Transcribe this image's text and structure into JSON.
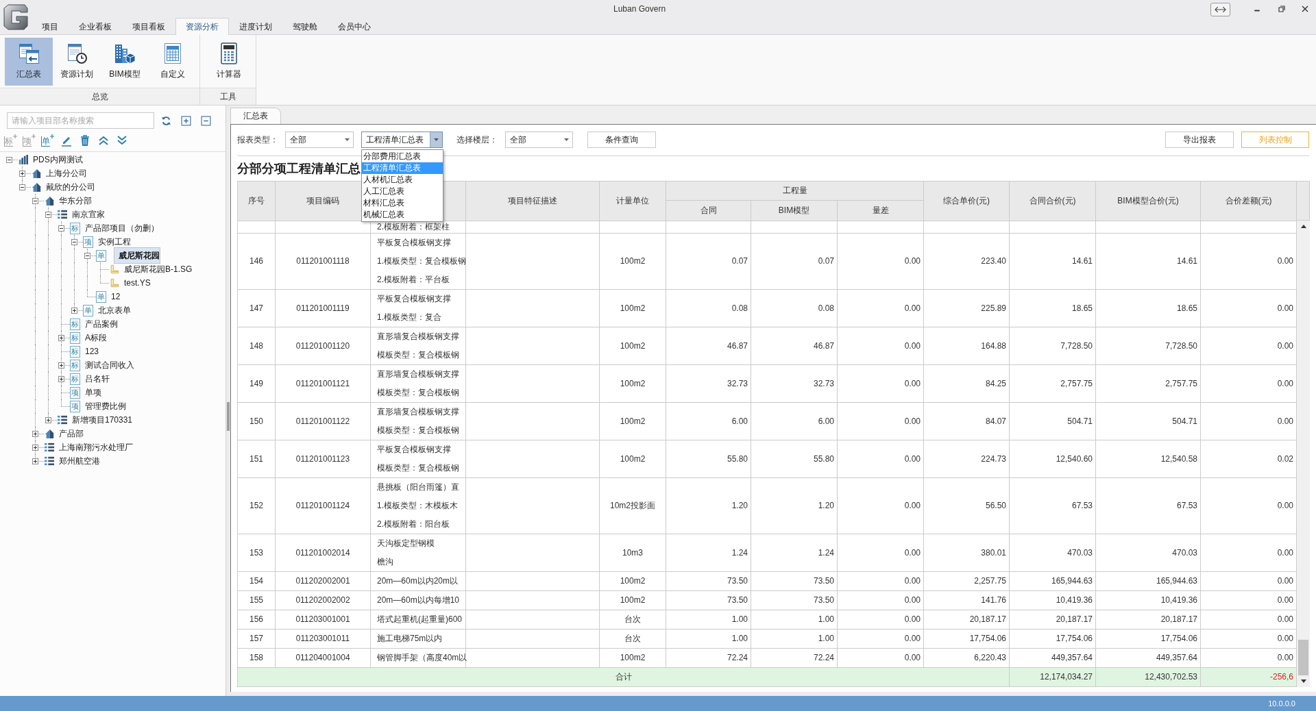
{
  "window": {
    "title": "Luban Govern"
  },
  "ribbon_tabs": [
    {
      "label": "项目",
      "selected": false
    },
    {
      "label": "企业看板",
      "selected": false
    },
    {
      "label": "项目看板",
      "selected": false
    },
    {
      "label": "资源分析",
      "selected": true
    },
    {
      "label": "进度计划",
      "selected": false
    },
    {
      "label": "驾驶舱",
      "selected": false
    },
    {
      "label": "会员中心",
      "selected": false
    }
  ],
  "ribbon_groups": [
    {
      "label": "总览",
      "buttons": [
        {
          "kind": "summary",
          "label": "汇总表",
          "selected": true
        },
        {
          "kind": "plan",
          "label": "资源计划",
          "selected": false
        },
        {
          "kind": "bim",
          "label": "BIM模型",
          "selected": false
        },
        {
          "kind": "custom",
          "label": "自定义",
          "selected": false
        }
      ]
    },
    {
      "label": "工具",
      "buttons": [
        {
          "kind": "calculator",
          "label": "计算器",
          "selected": false
        }
      ]
    }
  ],
  "sidebar": {
    "search": {
      "placeholder": "请输入项目部名称搜索"
    },
    "tools": [
      {
        "kind": "add",
        "label": "标",
        "disabled": true
      },
      {
        "kind": "add",
        "label": "项",
        "disabled": true
      },
      {
        "kind": "add",
        "label": "单",
        "disabled": false
      },
      {
        "kind": "edit",
        "disabled": false
      },
      {
        "kind": "delete",
        "disabled": false
      },
      {
        "kind": "move-up",
        "disabled": false
      },
      {
        "kind": "move-down",
        "disabled": false
      }
    ],
    "tree": [
      {
        "kind": "root",
        "label": "PDS内网测试",
        "expanded": true,
        "selected": false,
        "children": [
          {
            "kind": "office",
            "label": "上海分公司",
            "expanded": false,
            "selected": false
          },
          {
            "kind": "office",
            "label": "戴欣的分公司",
            "expanded": true,
            "selected": false,
            "children": [
              {
                "kind": "office",
                "label": "华东分部",
                "expanded": true,
                "selected": false,
                "children": [
                  {
                    "kind": "list",
                    "label": "南京宜家",
                    "expanded": true,
                    "selected": false,
                    "children": [
                      {
                        "kind": "badge",
                        "badge": "标",
                        "label": "产品部项目（勿删）",
                        "expanded": true,
                        "selected": false,
                        "children": [
                          {
                            "kind": "badge",
                            "badge": "项",
                            "label": "实例工程",
                            "expanded": true,
                            "selected": false,
                            "children": [
                              {
                                "kind": "badge",
                                "badge": "单",
                                "label": "威尼斯花园",
                                "expanded": true,
                                "selected": true,
                                "children": [
                                  {
                                    "kind": "file",
                                    "label": "威尼斯花园B-1.SG",
                                    "selected": false
                                  },
                                  {
                                    "kind": "file",
                                    "label": "test.YS",
                                    "selected": false
                                  }
                                ]
                              },
                              {
                                "kind": "badge",
                                "badge": "单",
                                "label": "12",
                                "selected": false
                              }
                            ]
                          },
                          {
                            "kind": "badge",
                            "badge": "单",
                            "label": "北京表单",
                            "expanded": false,
                            "selected": false
                          }
                        ]
                      },
                      {
                        "kind": "badge",
                        "badge": "标",
                        "label": "产品案例",
                        "selected": false
                      },
                      {
                        "kind": "badge",
                        "badge": "标",
                        "label": "A标段",
                        "expanded": false,
                        "selected": false
                      },
                      {
                        "kind": "badge",
                        "badge": "标",
                        "label": "123",
                        "selected": false
                      },
                      {
                        "kind": "badge",
                        "badge": "标",
                        "label": "测试合同收入",
                        "expanded": false,
                        "selected": false
                      },
                      {
                        "kind": "badge",
                        "badge": "标",
                        "label": "吕名轩",
                        "expanded": false,
                        "selected": false
                      },
                      {
                        "kind": "badge",
                        "badge": "项",
                        "label": "单项",
                        "selected": false
                      },
                      {
                        "kind": "badge",
                        "badge": "项",
                        "label": "管理费比例",
                        "selected": false
                      }
                    ]
                  },
                  {
                    "kind": "list",
                    "label": "新增项目170331",
                    "expanded": false,
                    "selected": false
                  }
                ]
              },
              {
                "kind": "office",
                "label": "产品部",
                "expanded": false,
                "selected": false
              },
              {
                "kind": "list",
                "label": "上海南翔污水处理厂",
                "expanded": false,
                "selected": false
              },
              {
                "kind": "list",
                "label": "郑州航空港",
                "expanded": false,
                "selected": false
              }
            ]
          }
        ]
      }
    ]
  },
  "document_tabs": [
    {
      "label": "汇总表",
      "selected": true
    }
  ],
  "filters": {
    "report_type": {
      "label": "报表类型：",
      "value": "全部"
    },
    "report": {
      "value": "工程清单汇总表",
      "open": true,
      "options": [
        {
          "label": "分部费用汇总表",
          "selected": false
        },
        {
          "label": "工程清单汇总表",
          "selected": true
        },
        {
          "label": "人材机汇总表",
          "selected": false
        },
        {
          "label": "人工汇总表",
          "selected": false
        },
        {
          "label": "材料汇总表",
          "selected": false
        },
        {
          "label": "机械汇总表",
          "selected": false
        }
      ]
    },
    "floor": {
      "label": "选择楼层：",
      "value": "全部"
    },
    "query_button": "条件查询"
  },
  "actions": [
    {
      "label": "导出报表",
      "highlighted": false
    },
    {
      "label": "列表控制",
      "highlighted": true
    }
  ],
  "report_title": "分部分项工程清单汇总",
  "table": {
    "columns": [
      {
        "kind": "text",
        "label": "序号"
      },
      {
        "kind": "text",
        "label": "项目编码"
      },
      {
        "kind": "blank"
      },
      {
        "kind": "text",
        "label": "项目特征描述"
      },
      {
        "kind": "text",
        "label": "计量单位"
      },
      {
        "kind": "group",
        "label": "工程量",
        "subcolumns": [
          "合同",
          "BIM模型",
          "量差"
        ]
      },
      {
        "kind": "text",
        "label": "综合单价(元)"
      },
      {
        "kind": "text",
        "label": "合同合价(元)"
      },
      {
        "kind": "text",
        "label": "BIM模型合价(元)"
      },
      {
        "kind": "text",
        "label": "合价差额(元)"
      }
    ],
    "rows": [
      {
        "kind": "clipped",
        "name": [
          "2.模板附着：框架柱"
        ]
      },
      {
        "kind": "item",
        "no": "146",
        "code": "011201001118",
        "name": [
          "平板复合模板钢支撑",
          "1.模板类型：复合模板钢",
          "2.模板附着：平台板"
        ],
        "unit": "100m2",
        "qty_contract": "0.07",
        "qty_bim": "0.07",
        "qty_diff": "0.00",
        "unit_price": "223.40",
        "total_contract": "14.61",
        "total_bim": "14.61",
        "total_diff": "0.00"
      },
      {
        "kind": "item",
        "no": "147",
        "code": "011201001119",
        "name": [
          "平板复合模板钢支撑",
          "1.模板类型：复合"
        ],
        "unit": "100m2",
        "qty_contract": "0.08",
        "qty_bim": "0.08",
        "qty_diff": "0.00",
        "unit_price": "225.89",
        "total_contract": "18.65",
        "total_bim": "18.65",
        "total_diff": "0.00"
      },
      {
        "kind": "item",
        "no": "148",
        "code": "011201001120",
        "name": [
          "直形墙复合模板钢支撑",
          "模板类型：复合模板钢"
        ],
        "unit": "100m2",
        "qty_contract": "46.87",
        "qty_bim": "46.87",
        "qty_diff": "0.00",
        "unit_price": "164.88",
        "total_contract": "7,728.50",
        "total_bim": "7,728.50",
        "total_diff": "0.00"
      },
      {
        "kind": "item",
        "no": "149",
        "code": "011201001121",
        "name": [
          "直形墙复合模板钢支撑",
          "模板类型：复合模板钢"
        ],
        "unit": "100m2",
        "qty_contract": "32.73",
        "qty_bim": "32.73",
        "qty_diff": "0.00",
        "unit_price": "84.25",
        "total_contract": "2,757.75",
        "total_bim": "2,757.75",
        "total_diff": "0.00"
      },
      {
        "kind": "item",
        "no": "150",
        "code": "011201001122",
        "name": [
          "直形墙复合模板钢支撑",
          "模板类型：复合模板钢"
        ],
        "unit": "100m2",
        "qty_contract": "6.00",
        "qty_bim": "6.00",
        "qty_diff": "0.00",
        "unit_price": "84.07",
        "total_contract": "504.71",
        "total_bim": "504.71",
        "total_diff": "0.00"
      },
      {
        "kind": "item",
        "no": "151",
        "code": "011201001123",
        "name": [
          "平板复合模板钢支撑",
          "模板类型：复合模板钢"
        ],
        "unit": "100m2",
        "qty_contract": "55.80",
        "qty_bim": "55.80",
        "qty_diff": "0.00",
        "unit_price": "224.73",
        "total_contract": "12,540.60",
        "total_bim": "12,540.58",
        "total_diff": "0.02"
      },
      {
        "kind": "item",
        "no": "152",
        "code": "011201001124",
        "name": [
          "悬挑板（阳台雨篷）直",
          "1.模板类型：木模板木",
          "2.模板附着：阳台板"
        ],
        "unit": "10m2投影面",
        "qty_contract": "1.20",
        "qty_bim": "1.20",
        "qty_diff": "0.00",
        "unit_price": "56.50",
        "total_contract": "67.53",
        "total_bim": "67.53",
        "total_diff": "0.00"
      },
      {
        "kind": "item",
        "no": "153",
        "code": "011201002014",
        "name": [
          "天沟板定型钢模",
          "檐沟"
        ],
        "unit": "10m3",
        "qty_contract": "1.24",
        "qty_bim": "1.24",
        "qty_diff": "0.00",
        "unit_price": "380.01",
        "total_contract": "470.03",
        "total_bim": "470.03",
        "total_diff": "0.00"
      },
      {
        "kind": "item",
        "no": "154",
        "code": "011202002001",
        "name": [
          "20m—60m以内20m以"
        ],
        "unit": "100m2",
        "qty_contract": "73.50",
        "qty_bim": "73.50",
        "qty_diff": "0.00",
        "unit_price": "2,257.75",
        "total_contract": "165,944.63",
        "total_bim": "165,944.63",
        "total_diff": "0.00"
      },
      {
        "kind": "item",
        "no": "155",
        "code": "011202002002",
        "name": [
          "20m—60m以内每增10"
        ],
        "unit": "100m2",
        "qty_contract": "73.50",
        "qty_bim": "73.50",
        "qty_diff": "0.00",
        "unit_price": "141.76",
        "total_contract": "10,419.36",
        "total_bim": "10,419.36",
        "total_diff": "0.00"
      },
      {
        "kind": "item",
        "no": "156",
        "code": "011203001001",
        "name": [
          "塔式起重机(起重量)600"
        ],
        "unit": "台次",
        "qty_contract": "1.00",
        "qty_bim": "1.00",
        "qty_diff": "0.00",
        "unit_price": "20,187.17",
        "total_contract": "20,187.17",
        "total_bim": "20,187.17",
        "total_diff": "0.00"
      },
      {
        "kind": "item",
        "no": "157",
        "code": "011203001011",
        "name": [
          "施工电梯75m以内"
        ],
        "unit": "台次",
        "qty_contract": "1.00",
        "qty_bim": "1.00",
        "qty_diff": "0.00",
        "unit_price": "17,754.06",
        "total_contract": "17,754.06",
        "total_bim": "17,754.06",
        "total_diff": "0.00"
      },
      {
        "kind": "item",
        "no": "158",
        "code": "011204001004",
        "name": [
          "钢管脚手架（高度40m以"
        ],
        "unit": "100m2",
        "qty_contract": "72.24",
        "qty_bim": "72.24",
        "qty_diff": "0.00",
        "unit_price": "6,220.43",
        "total_contract": "449,357.64",
        "total_bim": "449,357.64",
        "total_diff": "0.00"
      }
    ],
    "total": {
      "label": "合计",
      "total_contract": "12,174,034.27",
      "total_bim": "12,430,702.53",
      "total_diff": "-256,6",
      "negative": true
    }
  },
  "status_bar": {
    "version": "10.0.0.0"
  }
}
